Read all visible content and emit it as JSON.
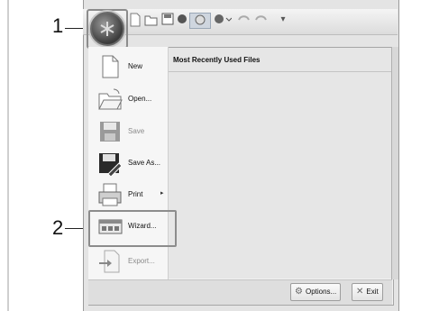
{
  "callouts": {
    "one": "1",
    "two": "2"
  },
  "menu": {
    "items": [
      {
        "label": "New",
        "enabled": true
      },
      {
        "label": "Open...",
        "enabled": true
      },
      {
        "label": "Save",
        "enabled": false
      },
      {
        "label": "Save As...",
        "enabled": true
      },
      {
        "label": "Print",
        "enabled": true,
        "submenu": true
      },
      {
        "label": "Wizard...",
        "enabled": true
      },
      {
        "label": "Export...",
        "enabled": false
      }
    ],
    "submenu_arrow": "▸"
  },
  "mru": {
    "title": "Most Recently Used Files"
  },
  "buttons": {
    "options": "Options...",
    "exit": "Exit"
  },
  "qat_dropdown": "▾",
  "colors": {
    "menu_bg": "#f2f2f2",
    "mru_bg": "#e6e6e6",
    "highlight_frame": "#8c8c8c"
  }
}
